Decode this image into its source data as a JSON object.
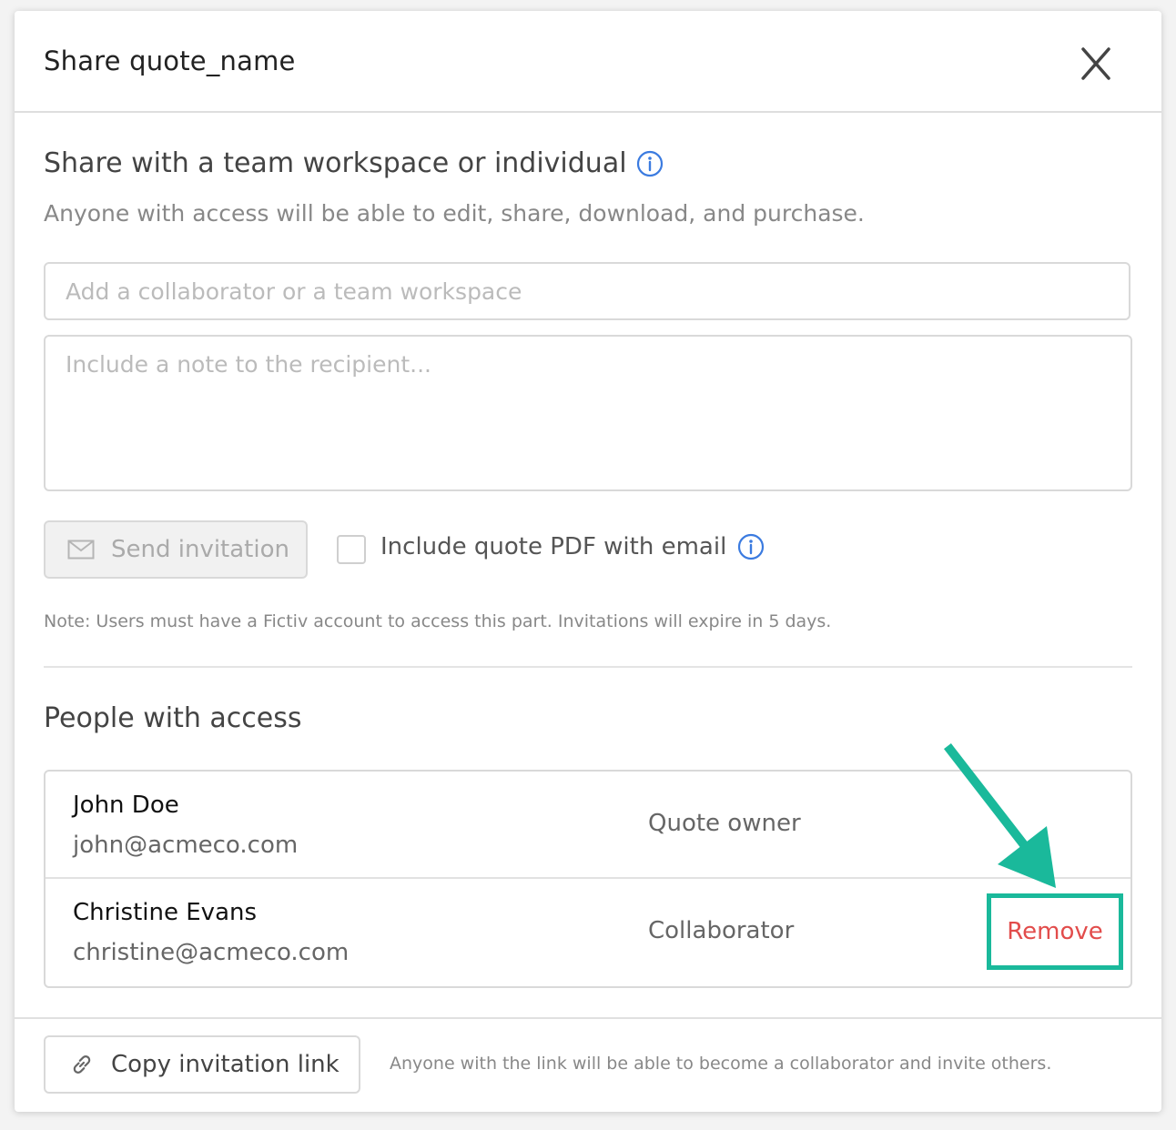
{
  "dialog": {
    "title": "Share quote_name",
    "close_label": "X"
  },
  "share": {
    "section_title": "Share with a team workspace or individual",
    "subtitle": "Anyone with access will be able to edit, share, download, and purchase.",
    "collaborator_placeholder": "Add a collaborator or a team workspace",
    "collaborator_value": "",
    "note_placeholder": "Include a note to the recipient...",
    "note_value": "",
    "send_label": "Send invitation",
    "include_pdf_label": "Include quote PDF with email",
    "include_pdf_checked": false,
    "note_text": "Note: Users must have a Fictiv account to access this part. Invitations will expire in 5 days."
  },
  "people": {
    "title": "People with access",
    "rows": [
      {
        "name": "John Doe",
        "email": "john@acmeco.com",
        "role": "Quote owner"
      },
      {
        "name": "Christine Evans",
        "email": "christine@acmeco.com",
        "role": "Collaborator",
        "action": "Remove"
      }
    ]
  },
  "footer": {
    "copy_label": "Copy invitation link",
    "copy_note": "Anyone with the link will be able to become a collaborator and invite others."
  },
  "colors": {
    "accent_info": "#3b7be0",
    "remove_text": "#e24c4b",
    "highlight": "#1ab99b"
  },
  "icons": {
    "close": "close-icon",
    "info": "info-icon",
    "mail": "mail-icon",
    "link": "link-icon",
    "arrow": "arrow-annotation-icon"
  }
}
